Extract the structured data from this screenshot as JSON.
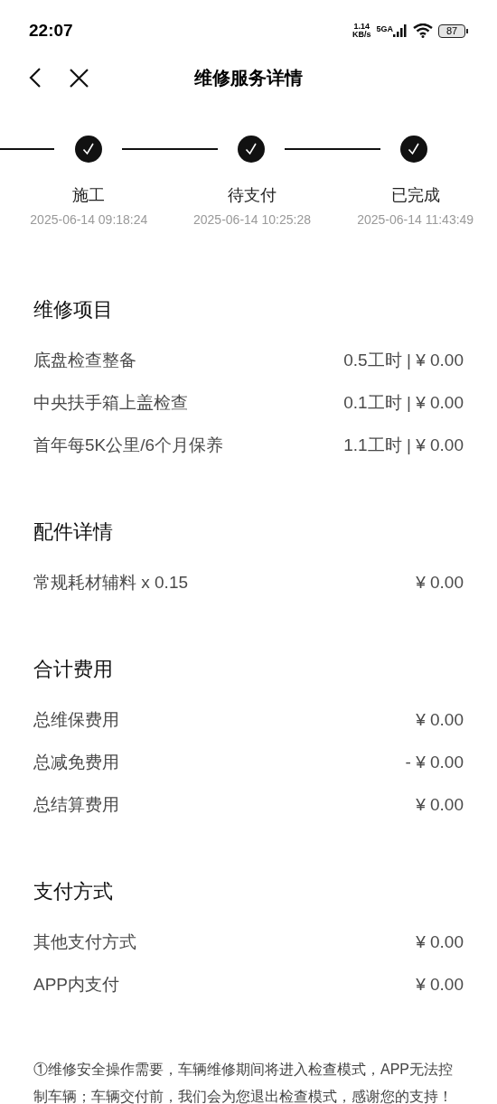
{
  "status_bar": {
    "time": "22:07",
    "speed_value": "1.14",
    "speed_unit": "KB/s",
    "network": "5GA",
    "battery": "87"
  },
  "header": {
    "title": "维修服务详情"
  },
  "steps": [
    {
      "label": "施工",
      "time": "2025-06-14 09:18:24",
      "done": true
    },
    {
      "label": "待支付",
      "time": "2025-06-14 10:25:28",
      "done": true
    },
    {
      "label": "已完成",
      "time": "2025-06-14 11:43:49",
      "done": true
    }
  ],
  "sections": [
    {
      "title": "维修项目",
      "rows": [
        {
          "label": "底盘检查整备",
          "value": "0.5工时 | ¥ 0.00"
        },
        {
          "label": "中央扶手箱上盖检查",
          "value": "0.1工时 | ¥ 0.00"
        },
        {
          "label": "首年每5K公里/6个月保养",
          "value": "1.1工时 | ¥ 0.00"
        }
      ]
    },
    {
      "title": "配件详情",
      "rows": [
        {
          "label": "常规耗材辅料 x 0.15",
          "value": "¥ 0.00"
        }
      ]
    },
    {
      "title": "合计费用",
      "rows": [
        {
          "label": "总维保费用",
          "value": "¥ 0.00"
        },
        {
          "label": "总减免费用",
          "value": "- ¥ 0.00"
        },
        {
          "label": "总结算费用",
          "value": "¥ 0.00"
        }
      ]
    },
    {
      "title": "支付方式",
      "rows": [
        {
          "label": "其他支付方式",
          "value": "¥ 0.00"
        },
        {
          "label": "APP内支付",
          "value": "¥ 0.00"
        }
      ]
    }
  ],
  "note": "①维修安全操作需要，车辆维修期间将进入检查模式，APP无法控制车辆；车辆交付前，我们会为您退出检查模式，感谢您的支持！"
}
